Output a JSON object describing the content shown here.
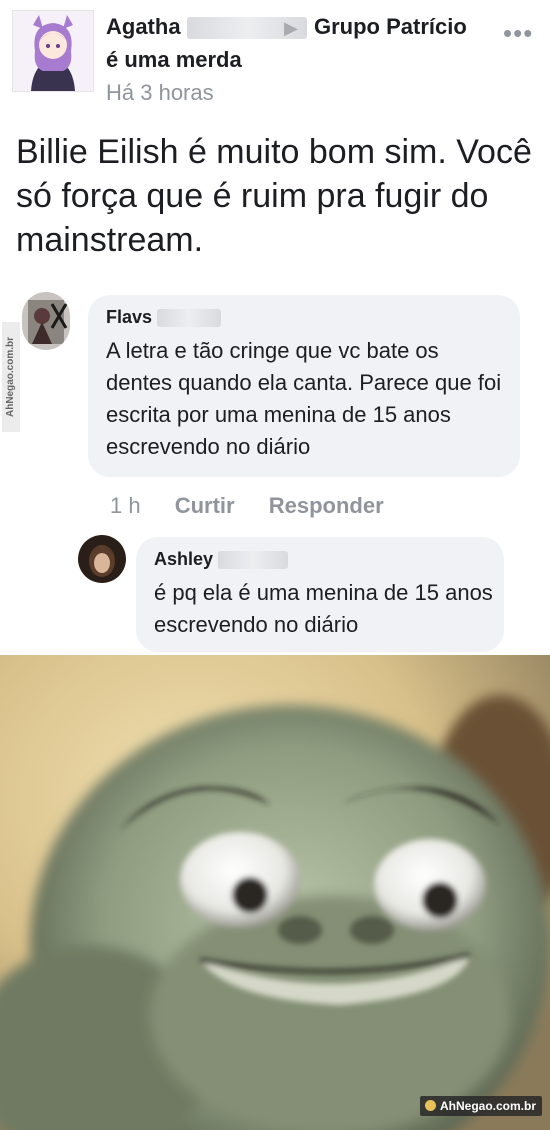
{
  "post": {
    "author_first_name": "Agatha",
    "group_name": "Grupo Patrício",
    "group_name_2": "é uma merda",
    "timestamp": "Há 3 horas",
    "more_label": "•••",
    "body": "Billie Eilish é muito bom sim. Você só força que é ruim pra fugir do mainstream."
  },
  "comments": [
    {
      "author": "Flavs",
      "text": "A letra e tão cringe que vc bate os dentes quando ela canta. Parece que foi escrita por uma menina de 15 anos escrevendo no diário",
      "time": "1 h",
      "like_label": "Curtir",
      "reply_label": "Responder"
    },
    {
      "author": "Ashley",
      "text": "é pq ela é uma menina de 15 anos escrevendo no diário"
    }
  ],
  "watermarks": {
    "side": "AhNegao.com.br",
    "bottom": "AhNegao.com.br"
  },
  "colors": {
    "bubble": "#f0f2f5",
    "secondary_text": "#90949c",
    "primary_text": "#1c1e21"
  }
}
